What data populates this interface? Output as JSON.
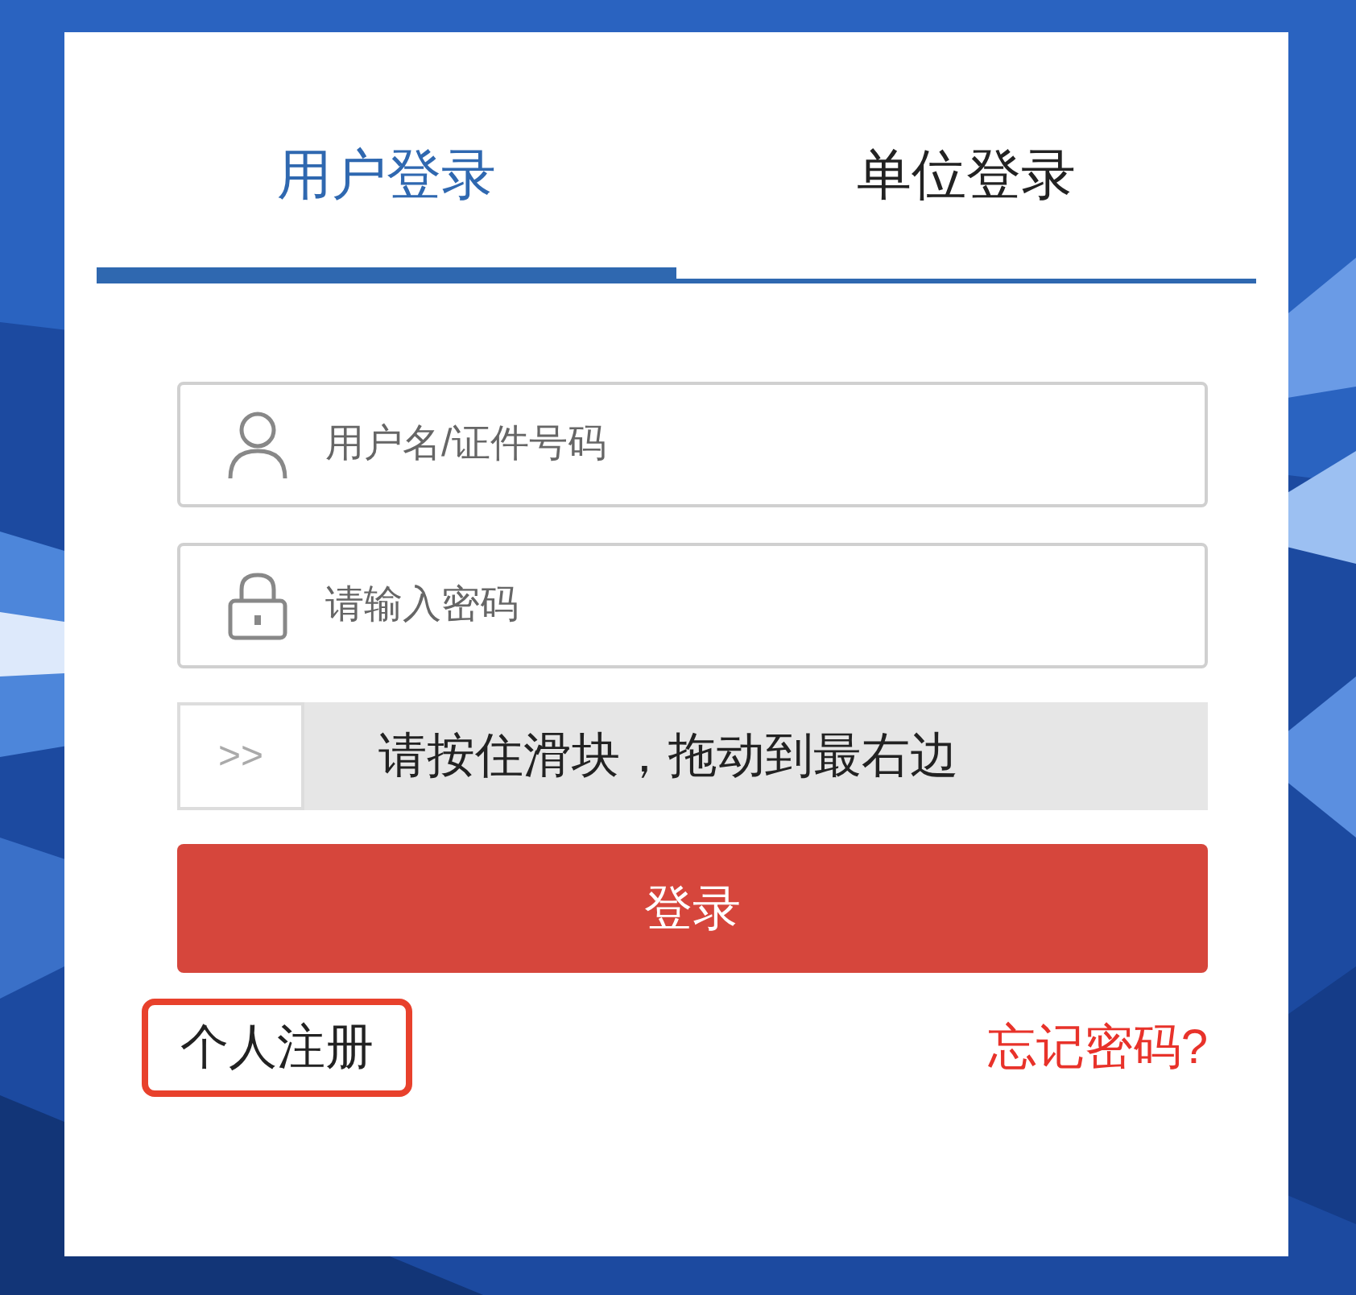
{
  "tabs": [
    {
      "label": "用户登录",
      "selected": true
    },
    {
      "label": "单位登录",
      "selected": false
    }
  ],
  "username": {
    "placeholder": "用户名/证件号码"
  },
  "password": {
    "placeholder": "请输入密码"
  },
  "slider": {
    "handle": ">>",
    "hint": "请按住滑块，拖动到最右边"
  },
  "login_button": "登录",
  "register_link": {
    "label": "个人注册",
    "highlighted": true
  },
  "forgot_link": "忘记密码?"
}
